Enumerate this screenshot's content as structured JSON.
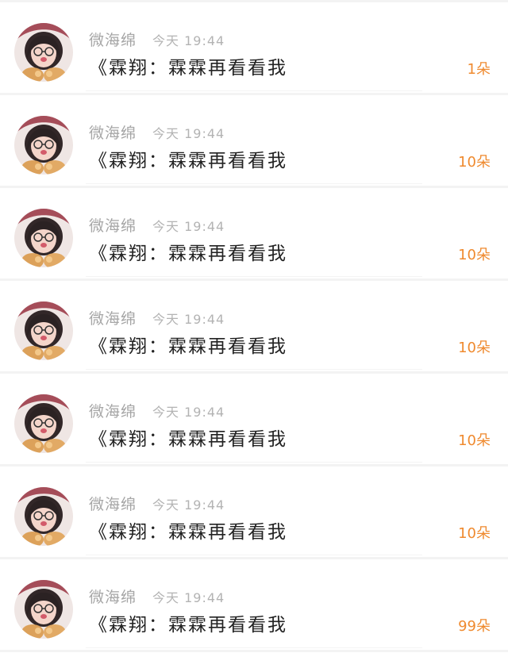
{
  "feed": {
    "items": [
      {
        "username": "微海绵",
        "time": "今天 19:44",
        "message": "《霖翔：霖霖再看看我",
        "gift": "1朵"
      },
      {
        "username": "微海绵",
        "time": "今天 19:44",
        "message": "《霖翔：霖霖再看看我",
        "gift": "10朵"
      },
      {
        "username": "微海绵",
        "time": "今天 19:44",
        "message": "《霖翔：霖霖再看看我",
        "gift": "10朵"
      },
      {
        "username": "微海绵",
        "time": "今天 19:44",
        "message": "《霖翔：霖霖再看看我",
        "gift": "10朵"
      },
      {
        "username": "微海绵",
        "time": "今天 19:44",
        "message": "《霖翔：霖霖再看看我",
        "gift": "10朵"
      },
      {
        "username": "微海绵",
        "time": "今天 19:44",
        "message": "《霖翔：霖霖再看看我",
        "gift": "10朵"
      },
      {
        "username": "微海绵",
        "time": "今天 19:44",
        "message": "《霖翔：霖霖再看看我",
        "gift": "99朵"
      }
    ]
  },
  "colors": {
    "username": "#a6a6a6",
    "time": "#b3b3b3",
    "message": "#222222",
    "gift": "#ef8a2f",
    "divider": "#f3f3f3"
  },
  "icons": {
    "avatar": "user-avatar-photo"
  }
}
